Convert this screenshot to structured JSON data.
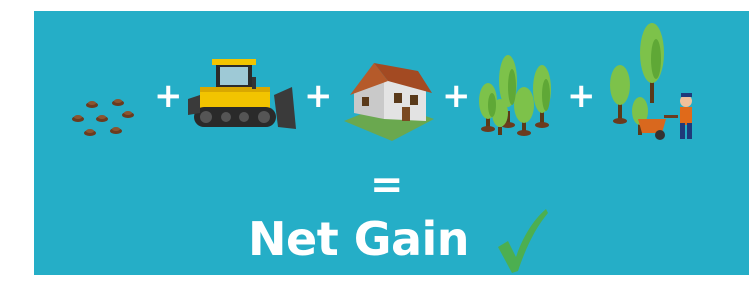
{
  "operators": {
    "plus": "+",
    "equals": "="
  },
  "result": {
    "title": "Net Gain"
  },
  "icons": [
    "soil-mounds-icon",
    "bulldozer-icon",
    "house-icon",
    "trees-icon",
    "gardener-trees-icon",
    "checkmark-icon"
  ],
  "colors": {
    "background": "#25aec7",
    "text": "#ffffff",
    "check": "#4caf50"
  }
}
